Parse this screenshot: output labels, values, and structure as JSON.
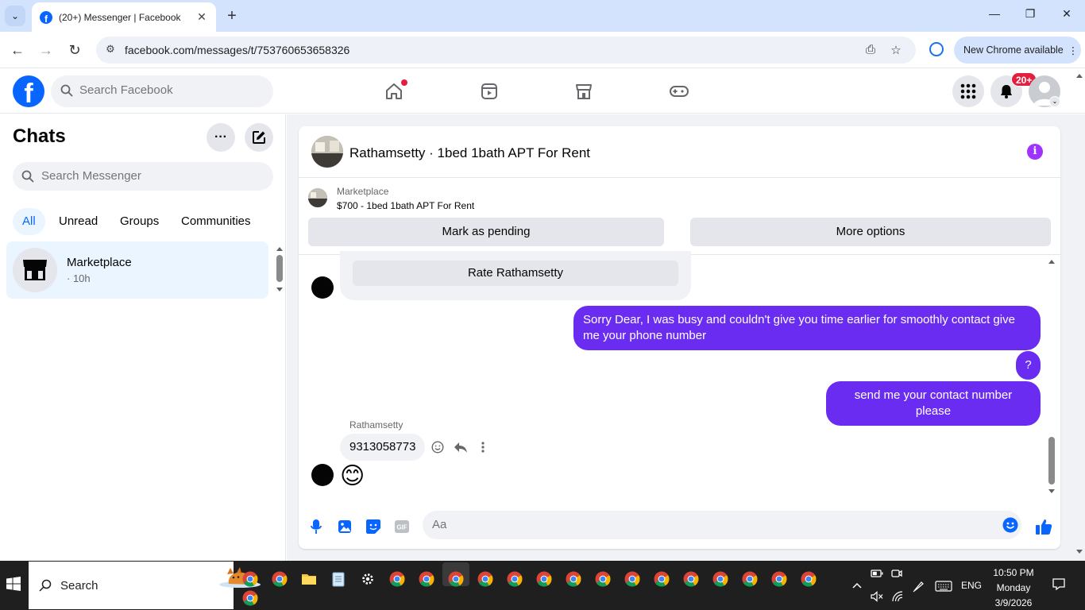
{
  "browser": {
    "tab_title": "(20+) Messenger | Facebook",
    "url": "facebook.com/messages/t/753760653658326",
    "new_chrome_label": "New Chrome available"
  },
  "header": {
    "search_placeholder": "Search Facebook",
    "notification_badge": "20+"
  },
  "sidebar": {
    "title": "Chats",
    "search_placeholder": "Search Messenger",
    "filters": [
      "All",
      "Unread",
      "Groups",
      "Communities"
    ],
    "active_filter": "All",
    "chats": [
      {
        "name": "Marketplace",
        "time": "· 10h"
      }
    ]
  },
  "conversation": {
    "title": "Rathamsetty · 1bed 1bath APT For Rent",
    "marketplace_label": "Marketplace",
    "listing": "$700 - 1bed 1bath APT For Rent",
    "mark_pending_label": "Mark as pending",
    "more_options_label": "More options",
    "rate_label": "Rate Rathamsetty",
    "messages": [
      {
        "from": "me",
        "text": "Sorry Dear, I was busy and couldn't give you time earlier for smoothly contact give me your phone number"
      },
      {
        "from": "me",
        "text": "?"
      },
      {
        "from": "me",
        "text": "send me your contact number please"
      },
      {
        "from": "Rathamsetty",
        "text": "9313058773"
      },
      {
        "from": "Rathamsetty",
        "text": "😊"
      }
    ],
    "sender_name": "Rathamsetty",
    "composer_placeholder": "Aa",
    "accent_color": "#6b2cf2"
  },
  "taskbar": {
    "search_label": "Search",
    "language": "ENG",
    "time": "10:50 PM",
    "day": "Monday",
    "date": "3/9/2026"
  }
}
